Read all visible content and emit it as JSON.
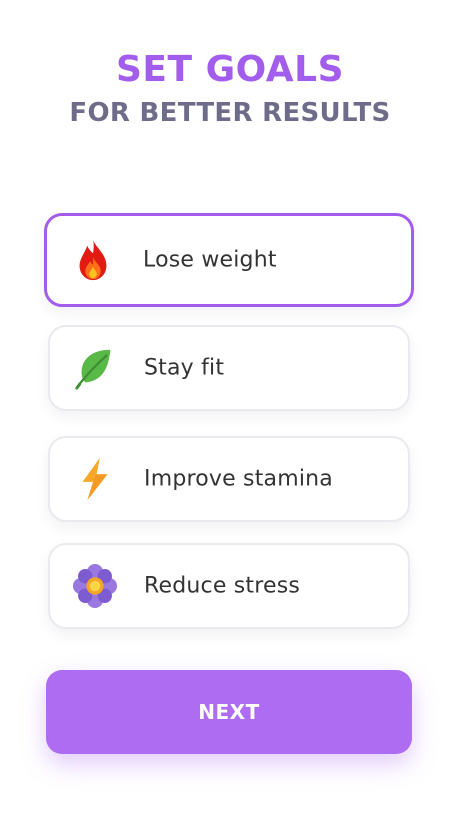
{
  "header": {
    "title": "SET GOALS",
    "subtitle": "FOR BETTER RESULTS"
  },
  "colors": {
    "accent": "#a35ded",
    "subtitle": "#6f6c89",
    "button": "#ad6cf2"
  },
  "options": [
    {
      "label": "Lose weight",
      "icon": "flame-icon",
      "selected": true
    },
    {
      "label": "Stay fit",
      "icon": "leaf-icon",
      "selected": false
    },
    {
      "label": "Improve stamina",
      "icon": "lightning-icon",
      "selected": false
    },
    {
      "label": "Reduce stress",
      "icon": "flower-icon",
      "selected": false
    }
  ],
  "next_button": {
    "label": "NEXT"
  }
}
